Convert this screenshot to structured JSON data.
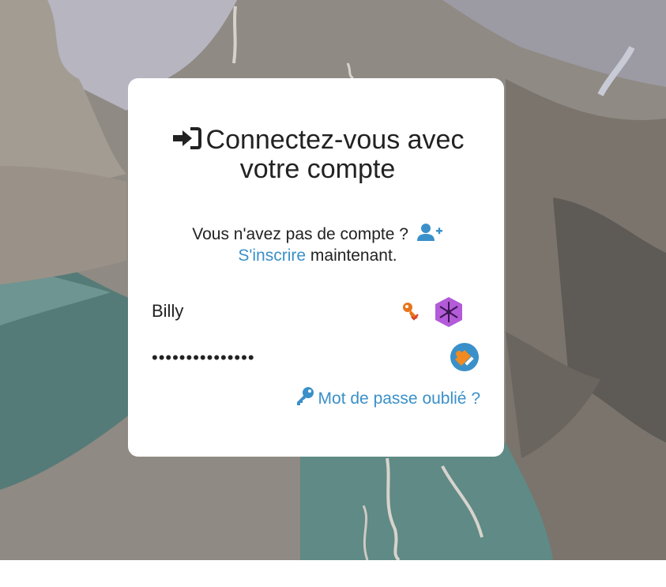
{
  "login": {
    "title": "Connectez-vous avec votre compte",
    "no_account_text": "Vous n'avez pas de compte ?",
    "signup_link": "S'inscrire",
    "signup_suffix": "maintenant.",
    "username_value": "Billy",
    "password_value": "•••••••••••••••",
    "forgot_password_link": "Mot de passe oublié ?"
  },
  "icons": {
    "title_icon": "sign-in-icon",
    "signup_icon": "user-plus-icon",
    "password_manager_icon": "key-icon",
    "extension_icon": "snowflake-hexagon-icon",
    "password_tool_icon": "key-circle-icon",
    "forgot_icon": "key-icon"
  },
  "colors": {
    "link": "#3a90c9",
    "text": "#222222",
    "card_background": "#ffffff"
  }
}
